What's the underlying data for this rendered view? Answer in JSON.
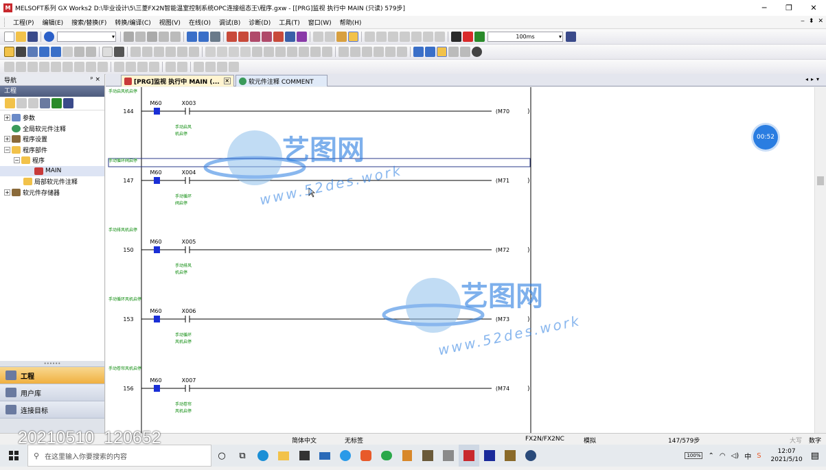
{
  "window": {
    "title": "MELSOFT系列 GX Works2 D:\\毕业设计\\5\\三菱FX2N智能温室控制系统OPC连接组态王\\程序.gxw - [[PRG]监视 执行中 MAIN (只读) 579步]",
    "app_icon_text": "M"
  },
  "menu": [
    "工程(P)",
    "编辑(E)",
    "搜索/替换(F)",
    "转换/编译(C)",
    "视图(V)",
    "在线(O)",
    "调试(B)",
    "诊断(D)",
    "工具(T)",
    "窗口(W)",
    "帮助(H)"
  ],
  "toolbar": {
    "scan_time": "100ms"
  },
  "nav": {
    "header": "导航",
    "pin": "ᵖ ×",
    "section": "工程",
    "tree": [
      {
        "label": "参数",
        "level": 0,
        "expand": "+"
      },
      {
        "label": "全局软元件注释",
        "level": 0,
        "expand": ""
      },
      {
        "label": "程序设置",
        "level": 0,
        "expand": "+"
      },
      {
        "label": "程序部件",
        "level": 0,
        "expand": "−"
      },
      {
        "label": "程序",
        "level": 1,
        "expand": "−"
      },
      {
        "label": "MAIN",
        "level": 2,
        "expand": ""
      },
      {
        "label": "局部软元件注释",
        "level": 1,
        "expand": ""
      },
      {
        "label": "软元件存储器",
        "level": 0,
        "expand": "+"
      }
    ],
    "bottom_items": [
      "工程",
      "用户库",
      "连接目标"
    ]
  },
  "tabs": [
    {
      "label": "[PRG]监视 执行中 MAIN (..."
    },
    {
      "label": "软元件注释 COMMENT"
    }
  ],
  "ladder": {
    "rungs": [
      {
        "step": "144",
        "comment": "手动启风机启停",
        "contact1": "M60",
        "contact2": "X003",
        "coil": "M70",
        "note1": "手动启风",
        "note2": "机启停"
      },
      {
        "step": "147",
        "comment": "手动循环阀启停",
        "contact1": "M60",
        "contact2": "X004",
        "coil": "M71",
        "note1": "手动循环",
        "note2": "阀启停"
      },
      {
        "step": "150",
        "comment": "手动排风机启停",
        "contact1": "M60",
        "contact2": "X005",
        "coil": "M72",
        "note1": "手动排风",
        "note2": "机启停"
      },
      {
        "step": "153",
        "comment": "手动循环风机启停",
        "contact1": "M60",
        "contact2": "X006",
        "coil": "M73",
        "note1": "手动循环",
        "note2": "风机启停"
      },
      {
        "step": "156",
        "comment": "手动卷帘风机启停",
        "contact1": "M60",
        "contact2": "X007",
        "coil": "M74",
        "note1": "手动卷帘",
        "note2": "风机启停"
      }
    ]
  },
  "timer": "00:52",
  "watermark": {
    "brand": "艺图网",
    "url": "www.52des.work"
  },
  "status": {
    "language": "简体中文",
    "title": "无标签",
    "plc": "FX2N/FX2NC",
    "mode": "模拟",
    "steps": "147/579步",
    "caps": "大写",
    "num": "数字"
  },
  "recording_stamp": "20210510_120652",
  "taskbar": {
    "search_placeholder": "在这里输入你要搜索的内容",
    "time": "12:07",
    "date": "2021/5/10",
    "battery": "100%",
    "ime": "中"
  },
  "colors": {
    "accent": "#2a7de1",
    "comment_green": "#0a8a0a",
    "coil_blue": "#1a2fd6"
  }
}
